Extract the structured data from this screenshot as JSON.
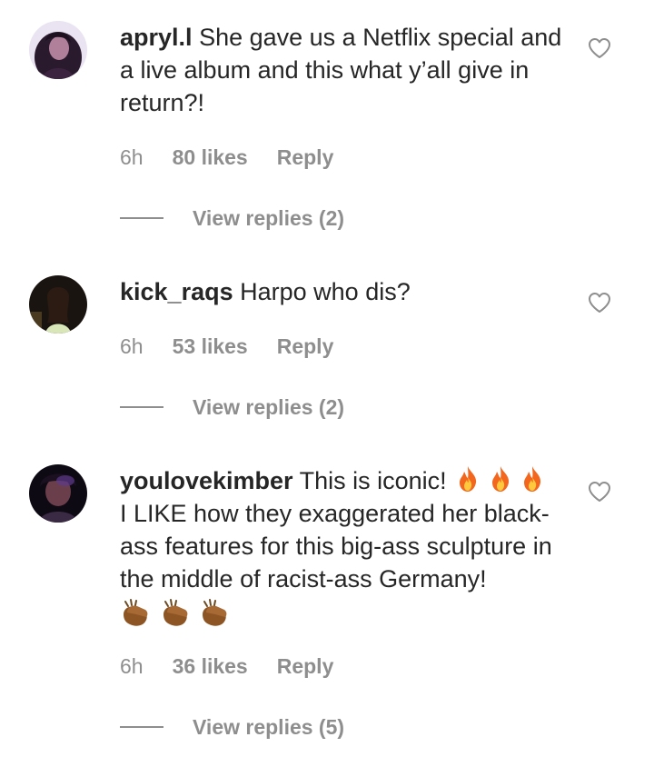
{
  "comments": [
    {
      "username": "apryl.l",
      "text": "She gave us a Netflix special and a live album and this what y’all give in return?!",
      "time": "6h",
      "likes": "80 likes",
      "reply": "Reply",
      "view_replies": "View replies (2)"
    },
    {
      "username": "kick_raqs",
      "text": "Harpo who dis?",
      "time": "6h",
      "likes": "53 likes",
      "reply": "Reply",
      "view_replies": "View replies (2)"
    },
    {
      "username": "youlovekimber",
      "text_line1": "This is iconic!",
      "text_rest": "I LIKE how they exaggerated her black-ass features for this big-ass sculpture in the middle of racist-ass Germany!",
      "time": "6h",
      "likes": "36 likes",
      "reply": "Reply",
      "view_replies": "View replies (5)"
    }
  ],
  "icons": {
    "like": "heart-outline-icon",
    "fire": "fire-emoji-icon",
    "clap": "clapping-hands-emoji-icon"
  },
  "colors": {
    "text": "#262626",
    "secondary": "#8e8e8e",
    "background": "#ffffff"
  }
}
